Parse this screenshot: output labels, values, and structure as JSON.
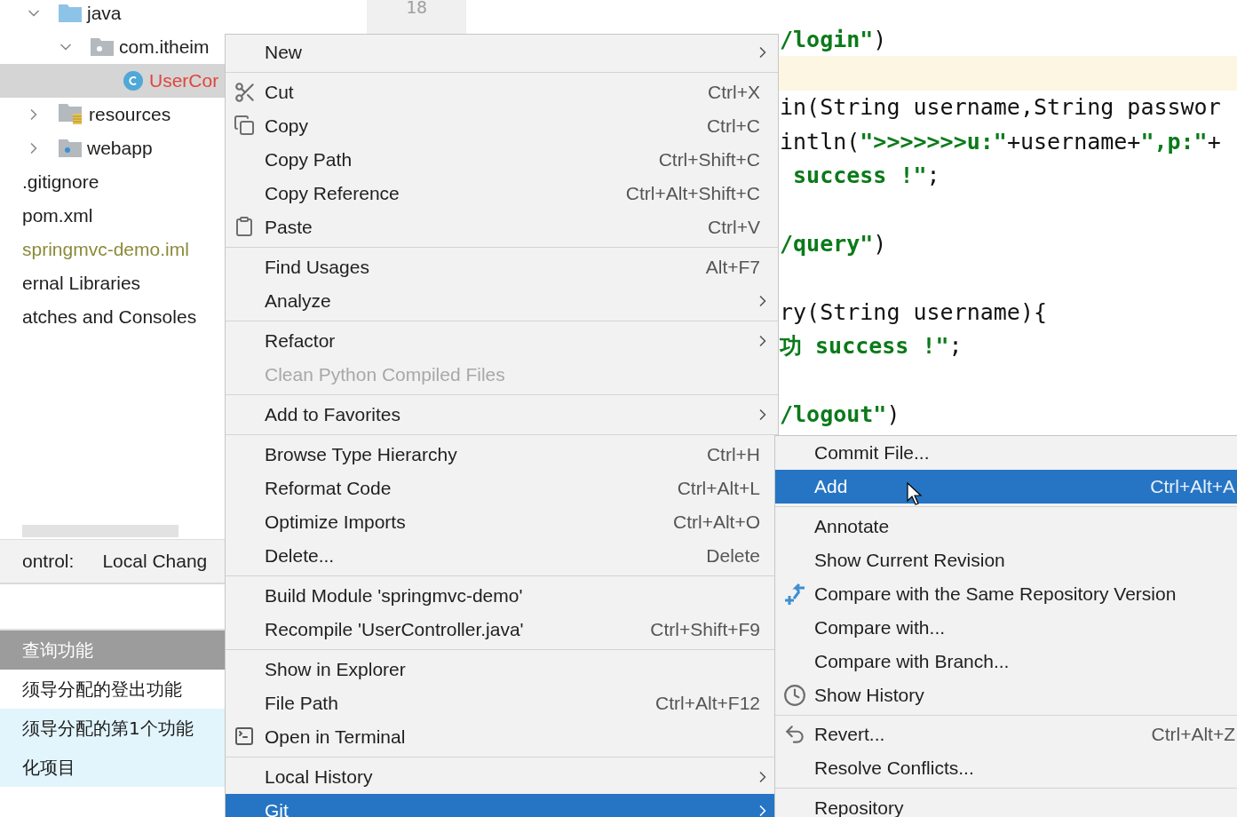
{
  "project_tree": [
    {
      "label": "java",
      "kind": "folder",
      "expanded": true,
      "children": [
        {
          "label": "com.itheim",
          "kind": "package",
          "expanded": true,
          "children": [
            {
              "label": "UserCor",
              "kind": "class",
              "selected": true,
              "color": "#e0453c"
            }
          ]
        }
      ]
    },
    {
      "label": "resources",
      "kind": "resources",
      "expanded": false
    },
    {
      "label": "webapp",
      "kind": "web",
      "expanded": false
    },
    {
      "label": ".gitignore",
      "kind": "file"
    },
    {
      "label": "pom.xml",
      "kind": "file"
    },
    {
      "label": "springmvc-demo.iml",
      "kind": "file",
      "color": "#8c8a3a"
    },
    {
      "label": "ernal Libraries",
      "kind": "file"
    },
    {
      "label": "atches and Consoles",
      "kind": "file"
    }
  ],
  "vcs_panel": {
    "title": "ontrol:",
    "tab": "Local Chang"
  },
  "commits": [
    {
      "message": "查询功能",
      "selected": true,
      "highlighted": false
    },
    {
      "message": "须导分配的登出功能",
      "selected": false,
      "highlighted": false
    },
    {
      "message": "须导分配的第1个功能",
      "selected": false,
      "highlighted": true
    },
    {
      "message": "化项目",
      "selected": false,
      "highlighted": true
    }
  ],
  "editor": {
    "gutter_line_number": "18",
    "lines": [
      {
        "current": false,
        "segments": [
          {
            "kind": "string",
            "text": "/login\""
          },
          {
            "kind": "plain",
            "text": ")"
          }
        ]
      },
      {
        "current": true
      },
      {
        "current": false,
        "segments": [
          {
            "kind": "plain",
            "text": "in(String username,String passwor"
          }
        ]
      },
      {
        "current": false,
        "segments": [
          {
            "kind": "plain",
            "text": "intln("
          },
          {
            "kind": "string",
            "text": "\">>>>>>>u:\""
          },
          {
            "kind": "plain",
            "text": "+username+"
          },
          {
            "kind": "string",
            "text": "\",p:\""
          },
          {
            "kind": "plain",
            "text": "+"
          }
        ]
      },
      {
        "current": false,
        "segments": [
          {
            "kind": "string",
            "text": " success !\""
          },
          {
            "kind": "plain",
            "text": ";"
          }
        ]
      },
      {
        "current": false
      },
      {
        "current": false,
        "segments": [
          {
            "kind": "string",
            "text": "/query\""
          },
          {
            "kind": "plain",
            "text": ")"
          }
        ]
      },
      {
        "current": false
      },
      {
        "current": false,
        "segments": [
          {
            "kind": "plain",
            "text": "ry(String username){"
          }
        ]
      },
      {
        "current": false,
        "segments": [
          {
            "kind": "string",
            "text": "功 success !\""
          },
          {
            "kind": "plain",
            "text": ";"
          }
        ]
      },
      {
        "current": false
      },
      {
        "current": false,
        "segments": [
          {
            "kind": "string",
            "text": "/logout\""
          },
          {
            "kind": "plain",
            "text": ")"
          }
        ]
      }
    ]
  },
  "context_menu": {
    "sections": [
      [
        {
          "label": "New",
          "selected": false,
          "disabled": false,
          "has_submenu": true
        }
      ],
      [
        {
          "label": "Cut",
          "kind": "cut",
          "shortcut": "Ctrl+X",
          "selected": false,
          "disabled": false,
          "has_submenu": false
        },
        {
          "label": "Copy",
          "kind": "copy",
          "shortcut": "Ctrl+C",
          "selected": false,
          "disabled": false,
          "has_submenu": false
        },
        {
          "label": "Copy Path",
          "shortcut": "Ctrl+Shift+C",
          "selected": false,
          "disabled": false,
          "has_submenu": false
        },
        {
          "label": "Copy Reference",
          "shortcut": "Ctrl+Alt+Shift+C",
          "selected": false,
          "disabled": false,
          "has_submenu": false
        },
        {
          "label": "Paste",
          "kind": "paste",
          "shortcut": "Ctrl+V",
          "selected": false,
          "disabled": false,
          "has_submenu": false
        }
      ],
      [
        {
          "label": "Find Usages",
          "shortcut": "Alt+F7",
          "selected": false,
          "disabled": false,
          "has_submenu": false
        },
        {
          "label": "Analyze",
          "selected": false,
          "disabled": false,
          "has_submenu": true
        }
      ],
      [
        {
          "label": "Refactor",
          "selected": false,
          "disabled": false,
          "has_submenu": true
        },
        {
          "label": "Clean Python Compiled Files",
          "selected": false,
          "disabled": true,
          "has_submenu": false
        }
      ],
      [
        {
          "label": "Add to Favorites",
          "selected": false,
          "disabled": false,
          "has_submenu": true
        }
      ],
      [
        {
          "label": "Browse Type Hierarchy",
          "shortcut": "Ctrl+H",
          "selected": false,
          "disabled": false,
          "has_submenu": false
        },
        {
          "label": "Reformat Code",
          "shortcut": "Ctrl+Alt+L",
          "selected": false,
          "disabled": false,
          "has_submenu": false
        },
        {
          "label": "Optimize Imports",
          "shortcut": "Ctrl+Alt+O",
          "selected": false,
          "disabled": false,
          "has_submenu": false
        },
        {
          "label": "Delete...",
          "shortcut": "Delete",
          "selected": false,
          "disabled": false,
          "has_submenu": false
        }
      ],
      [
        {
          "label": "Build Module 'springmvc-demo'",
          "selected": false,
          "disabled": false,
          "has_submenu": false
        },
        {
          "label": "Recompile 'UserController.java'",
          "shortcut": "Ctrl+Shift+F9",
          "selected": false,
          "disabled": false,
          "has_submenu": false
        }
      ],
      [
        {
          "label": "Show in Explorer",
          "selected": false,
          "disabled": false,
          "has_submenu": false
        },
        {
          "label": "File Path",
          "shortcut": "Ctrl+Alt+F12",
          "selected": false,
          "disabled": false,
          "has_submenu": false
        },
        {
          "label": "Open in Terminal",
          "kind": "terminal",
          "selected": false,
          "disabled": false,
          "has_submenu": false
        }
      ],
      [
        {
          "label": "Local History",
          "selected": false,
          "disabled": false,
          "has_submenu": true
        },
        {
          "label": "Git",
          "selected": true,
          "disabled": false,
          "has_submenu": true
        }
      ]
    ]
  },
  "git_submenu": {
    "sections": [
      [
        {
          "label": "Commit File...",
          "selected": false
        },
        {
          "label": "Add",
          "shortcut": "Ctrl+Alt+A",
          "selected": true
        }
      ],
      [
        {
          "label": "Annotate",
          "selected": false
        },
        {
          "label": "Show Current Revision",
          "selected": false
        },
        {
          "label": "Compare with the Same Repository Version",
          "kind": "compare",
          "selected": false
        },
        {
          "label": "Compare with...",
          "selected": false
        },
        {
          "label": "Compare with Branch...",
          "selected": false
        },
        {
          "label": "Show History",
          "kind": "history",
          "selected": false
        }
      ],
      [
        {
          "label": "Revert...",
          "kind": "revert",
          "shortcut": "Ctrl+Alt+Z",
          "selected": false
        },
        {
          "label": "Resolve Conflicts...",
          "selected": false
        }
      ],
      [
        {
          "label": "Repository",
          "selected": false
        }
      ]
    ]
  }
}
